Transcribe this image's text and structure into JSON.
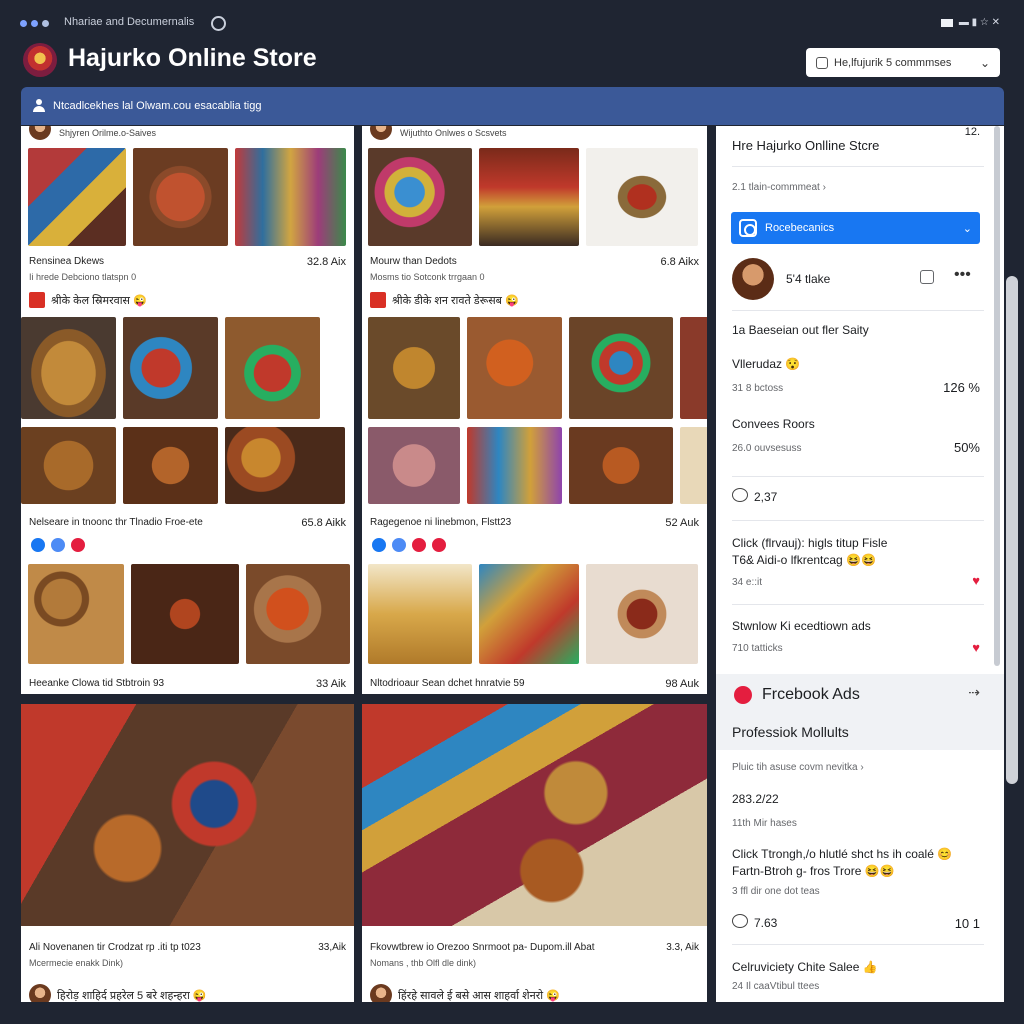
{
  "browser": {
    "tab_title": "Nhariae and Decumernalis",
    "window_controls": "▬ ▮ ☆ ✕"
  },
  "header": {
    "store_title": "Hajurko Online Store",
    "filter_label": "He,lfujurik 5 commmses"
  },
  "bluebar": {
    "text": "Ntcadlcekhes  lal  Olwam.cou esacablia tigg"
  },
  "feed": {
    "col1": {
      "poster": "Shjyren Orilme.o-Saives",
      "post1": {
        "title": "Rensinea Dkews",
        "price": "32.8 Aix",
        "sub": "Ii hrede Debciono tlatspn 0",
        "react_text": "श्रीके केल स्रिमरवास 😜"
      },
      "post2": {
        "title": "Nelseare in tnoonc thr Tlnadio Froe-ete",
        "price": "65.8 Aikk"
      },
      "post3": {
        "title": "Heeanke Clowa tid Stbtroin 93",
        "price": "33 Aik"
      }
    },
    "col2": {
      "poster": "Wijuthto Onlwes o Scsvets",
      "post1": {
        "title": "Mourw than Dedots",
        "price": "6.8 Aikx",
        "sub": "Mosms tio Sotconk trrgaan 0",
        "react_text": "श्रीके डीके शन रावते डेरूसब 😜"
      },
      "post2": {
        "title": "Ragegenoe ni linebmon, Flstt23",
        "price": "52 Auk"
      },
      "post3": {
        "title": "Nltodrioaur Sean dchet hnratvie 59",
        "price": "98 Auk"
      }
    }
  },
  "bottom_posts": [
    {
      "caption": "Ali Novenanen tir Crodzat rp .iti tp t023",
      "price": "33,Aik",
      "sub": "Mcermecie enakk Dink)",
      "react_text": "हिरोड़ शाहिर्द प्रहरेल 5 बरे शहन्हरा 😜"
    },
    {
      "caption": "Fkovwtbrew io Orezoo Snrmoot pa- Dupom.ill Abat",
      "price": "3.3, Aik",
      "sub": "Nomans , thb Olfl dle dink)",
      "react_text": "हिंरहे सावले ई बसे आस शाहर्वा शेनरो 😜"
    }
  ],
  "right_panel": {
    "header_title": "Hre Hajurko Onlline Stcre",
    "header_time": "12.",
    "comment_line": "2.1 tlain-commmeat ›",
    "page_select": "Rocebecanics",
    "profile_likes": "5'4 tlake",
    "row1_text": "1a Baeseian out fler Saity",
    "row2_label": "Vllerudaz 😯",
    "row2_sub": "31 8 bctoss",
    "row2_value": "126 %",
    "row3_label": "Convees Roors",
    "row3_sub": "26.0 ouvsesuss",
    "row3_value": "50%",
    "row4_value": "2,37",
    "row5_line1": "Click (flrvauj): higls titup Fisle",
    "row5_line2": "T6& Aidi-o lfkrentcag 😆😆",
    "row5_sub": "34 e::it",
    "row6_label": "Stwnlow Ki ecedtiown ads",
    "row6_sub": "710 tatticks",
    "fb_title": "Frcebook Ads",
    "fb_sub": "Professiok Mollults",
    "row7_text": "Pluic tih asuse covm nevitka ›",
    "row8_value": "283.2/22",
    "row8_sub": "11th Mir hases",
    "row9_line1": "Click Ttrongh,/o hlutlé shct hs ih coalé 😊",
    "row9_line2": "Fartn-Btroh g- fros Trore 😆😆",
    "row9_sub": "3 ffl dir one dot teas",
    "row10_left": "7.63",
    "row10_right": "10 1",
    "row11_label": "Celruviciety Chite Salee 👍",
    "row11_sub": "24 Il caaVtibul ttees"
  }
}
